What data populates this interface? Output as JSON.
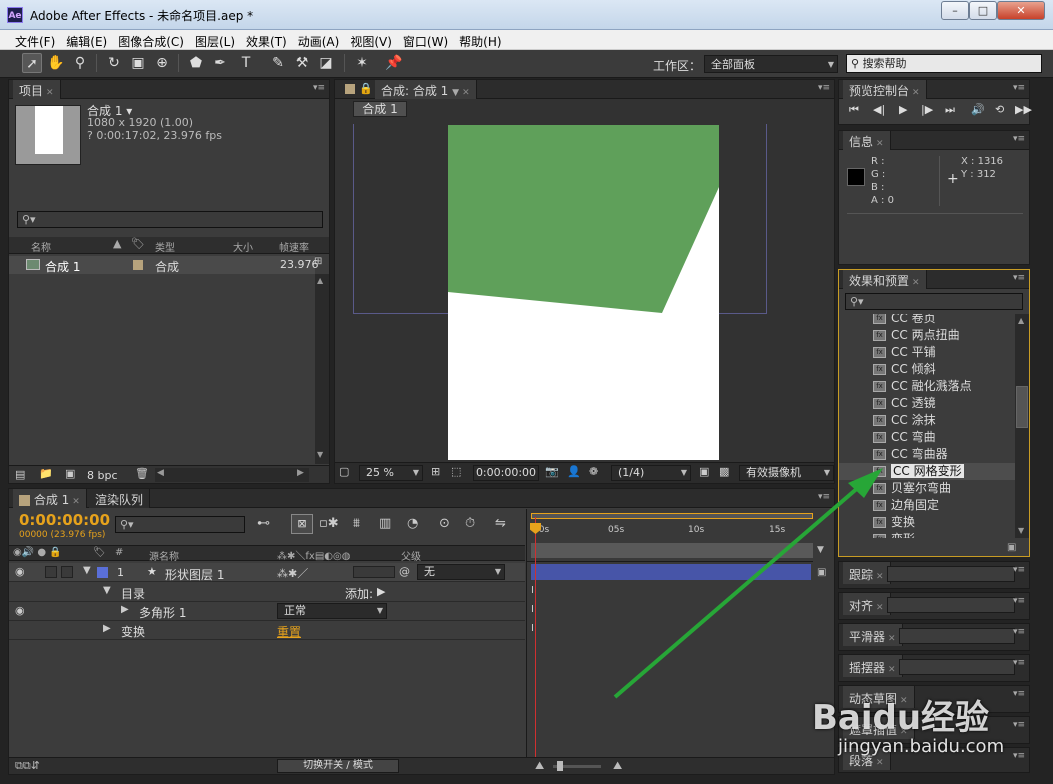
{
  "window": {
    "title": "Adobe After Effects - 未命名项目.aep *",
    "app_icon": "Ae",
    "minimize": "–",
    "maximize": "□",
    "close": "✕"
  },
  "menu": [
    "文件(F)",
    "编辑(E)",
    "图像合成(C)",
    "图层(L)",
    "效果(T)",
    "动画(A)",
    "视图(V)",
    "窗口(W)",
    "帮助(H)"
  ],
  "toolbar": {
    "workspace_label": "工作区：",
    "workspace_value": "全部面板",
    "search_placeholder": "搜索帮助"
  },
  "project": {
    "tab": "项目",
    "comp_name": "合成 1 ▾",
    "comp_size": "1080 x 1920 (1.00)",
    "comp_duration": "? 0:00:17:02, 23.976 fps",
    "columns": [
      "名称",
      "类型",
      "大小",
      "帧速率"
    ],
    "items": [
      {
        "name": "合成 1",
        "type": "合成",
        "fps": "23.976"
      }
    ],
    "bpc": "8 bpc"
  },
  "comp": {
    "tab": "合成: 合成 1",
    "breadcrumb": "合成 1",
    "zoom": "25 %",
    "timecode": "0:00:00:00",
    "resolution": "(1/4)",
    "camera": "有效摄像机",
    "shape_color": "#5fa05a"
  },
  "preview": {
    "tab": "预览控制台"
  },
  "info": {
    "tab": "信息",
    "r": "R :",
    "g": "G :",
    "b": "B :",
    "a": "A : 0",
    "x": "X : 1316",
    "y": "Y : 312"
  },
  "effects": {
    "tab": "效果和预置",
    "items": [
      "CC 卷页",
      "CC 两点扭曲",
      "CC 平铺",
      "CC 倾斜",
      "CC 融化溅落点",
      "CC 透镜",
      "CC 涂抹",
      "CC 弯曲",
      "CC 弯曲器",
      "CC 网格变形",
      "贝塞尔弯曲",
      "边角固定",
      "变换",
      "变形"
    ],
    "selected": "CC 网格变形"
  },
  "side_panels": [
    "跟踪",
    "对齐",
    "平滑器",
    "摇摆器",
    "动态草图",
    "遮罩插值",
    "段落"
  ],
  "timeline": {
    "tab": "合成 1",
    "tab2": "渲染队列",
    "timecode": "0:00:00:00",
    "frame_info": "00000 (23.976 fps)",
    "col_source": "源名称",
    "col_parent": "父级",
    "layer_num": "1",
    "layer_name": "形状图层 1",
    "parent_value": "无",
    "contents_label": "目录",
    "add_label": "添加:",
    "polygon_label": "多角形 1",
    "blend_value": "正常",
    "transform_label": "变换",
    "reset_label": "重置",
    "toggle_label": "切换开关 / 模式",
    "ruler": [
      "00s",
      "05s",
      "10s",
      "15s"
    ],
    "layer_bar_color": "#4755a8",
    "accent": "#e6a21c"
  },
  "watermark": {
    "brand": "Baidu经验",
    "url": "jingyan.baidu.com"
  }
}
